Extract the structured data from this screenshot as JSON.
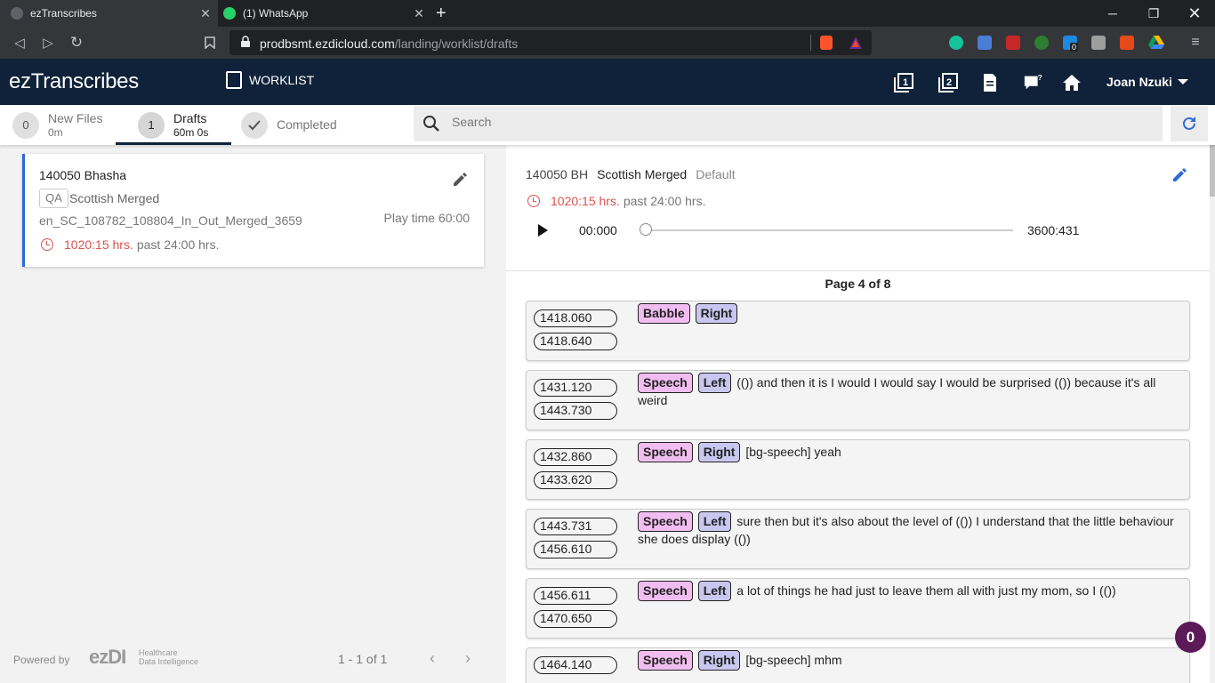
{
  "browser": {
    "tabs": [
      {
        "title": "ezTranscribes",
        "active": true
      },
      {
        "title": "(1) WhatsApp",
        "active": false
      }
    ],
    "url_domain": "prodbsmt.ezdicloud.com",
    "url_path": "/landing/worklist/drafts",
    "extension_badge": "0"
  },
  "header": {
    "logo": "ezTranscribes",
    "worklist_label": "WORKLIST",
    "user_name": "Joan Nzuki"
  },
  "worklist_tabs": [
    {
      "badge": "0",
      "label": "New Files",
      "sub": "0m"
    },
    {
      "badge": "1",
      "label": "Drafts",
      "sub": "60m 0s"
    },
    {
      "label": "Completed"
    }
  ],
  "search": {
    "placeholder": "Search"
  },
  "card": {
    "title": "140050 Bhasha",
    "qa": "QA",
    "language": "Scottish Merged",
    "filename": "en_SC_108782_108804_In_Out_Merged_3659",
    "playtime": "Play time 60:00",
    "due_red": "1020:15 hrs.",
    "due_gray": "past 24:00 hrs."
  },
  "footer": {
    "powered_by": "Powered by",
    "logo": "ezDI",
    "logo_tag_1": "Healthcare",
    "logo_tag_2": "Data Intelligence",
    "pager": "1 - 1 of 1"
  },
  "detail": {
    "code": "140050 BH",
    "language": "Scottish Merged",
    "mode": "Default",
    "due_red": "1020:15 hrs.",
    "due_gray": "past 24:00 hrs.",
    "time_start": "00:000",
    "time_end": "3600:431",
    "progress": 0,
    "page_info": "Page 4 of 8"
  },
  "segments": [
    {
      "start": "1418.060",
      "end": "1418.640",
      "type": "Babble",
      "side": "Right",
      "text": ""
    },
    {
      "start": "1431.120",
      "end": "1443.730",
      "type": "Speech",
      "side": "Left",
      "text": "(()) and then it is I would I would say I would be surprised (()) because it's all weird"
    },
    {
      "start": "1432.860",
      "end": "1433.620",
      "type": "Speech",
      "side": "Right",
      "text": "[bg-speech] yeah"
    },
    {
      "start": "1443.731",
      "end": "1456.610",
      "type": "Speech",
      "side": "Left",
      "text": "sure then but it's also about the level of (()) I understand that the little behaviour she does display (())"
    },
    {
      "start": "1456.611",
      "end": "1470.650",
      "type": "Speech",
      "side": "Left",
      "text": "a lot of things he had just to leave them all with just my mom, so I (())"
    },
    {
      "start": "1464.140",
      "end": "",
      "type": "Speech",
      "side": "Right",
      "text": "[bg-speech] mhm"
    }
  ],
  "fab_count": "0",
  "colors": {
    "appbar": "#0f2239",
    "accent": "#2e6ad6",
    "due": "#d9534f",
    "speech_tag": "#f1bdf0",
    "side_tag": "#c9c7f0",
    "fab": "#5c1a58"
  }
}
